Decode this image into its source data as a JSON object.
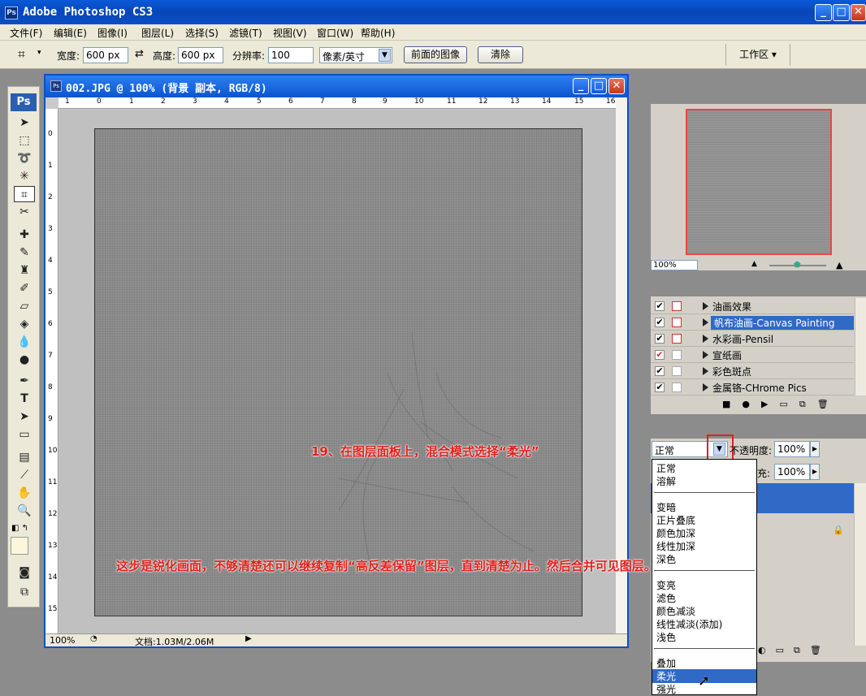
{
  "app": {
    "title": "Adobe Photoshop CS3",
    "ps_icon": "Ps"
  },
  "menu": [
    "文件(F)",
    "编辑(E)",
    "图像(I)",
    "图层(L)",
    "选择(S)",
    "滤镜(T)",
    "视图(V)",
    "窗口(W)",
    "帮助(H)"
  ],
  "options": {
    "width_label": "宽度:",
    "width_value": "600 px",
    "height_label": "高度:",
    "height_value": "600 px",
    "res_label": "分辨率:",
    "res_value": "100",
    "unit_value": "像素/英寸",
    "front_image_btn": "前面的图像",
    "clear_btn": "清除",
    "workspace": "工作区 ▾"
  },
  "toolbox": {
    "head": "Ps"
  },
  "document": {
    "title": "002.JPG @ 100% (背景 副本, RGB/8)",
    "zoom": "100%",
    "doc_size": "文档:1.03M/2.06M",
    "hruler": [
      "1",
      "0",
      "1",
      "2",
      "3",
      "4",
      "5",
      "6",
      "7",
      "8",
      "9",
      "10",
      "11",
      "12",
      "13",
      "14",
      "15",
      "16"
    ],
    "vruler": [
      "0",
      "1",
      "2",
      "3",
      "4",
      "5",
      "6",
      "7",
      "8",
      "9",
      "10",
      "11",
      "12",
      "13",
      "14",
      "15"
    ]
  },
  "navigator": {
    "zoom": "100%"
  },
  "actions": [
    {
      "name": "油画效果",
      "checked": true,
      "dlg": "red",
      "selected": false
    },
    {
      "name": "帆布油画-Canvas Painting",
      "checked": true,
      "dlg": "red",
      "selected": true
    },
    {
      "name": "水彩画-Pensil",
      "checked": true,
      "dlg": "red",
      "selected": false
    },
    {
      "name": "宣纸画",
      "checked": true,
      "dlg": "none",
      "selected": false
    },
    {
      "name": "彩色斑点",
      "checked": true,
      "dlg": "none",
      "selected": false
    },
    {
      "name": "金属铬-CHrome Pics",
      "checked": true,
      "dlg": "none",
      "selected": false
    }
  ],
  "layers": {
    "blend_mode": "正常",
    "opacity_label": "不透明度:",
    "opacity_value": "100%",
    "fill_label": "充:",
    "fill_value": "100%"
  },
  "blend_options": {
    "group1": [
      "正常",
      "溶解"
    ],
    "group2": [
      "变暗",
      "正片叠底",
      "颜色加深",
      "线性加深",
      "深色"
    ],
    "group3": [
      "变亮",
      "滤色",
      "颜色减淡",
      "线性减淡(添加)",
      "浅色"
    ],
    "group4": [
      "叠加",
      "柔光",
      "强光"
    ],
    "selected": "柔光"
  },
  "annotations": {
    "step": "19、在图层面板上，混合模式选择“柔光”",
    "note": "这步是锐化画面，不够清楚还可以继续复制“高反差保留”图层，直到清楚为止。然后合并可见图层。"
  },
  "colors": {
    "title_blue": "#0a55cf",
    "selection": "#3169c6",
    "annotation_red": "#e0201b"
  }
}
